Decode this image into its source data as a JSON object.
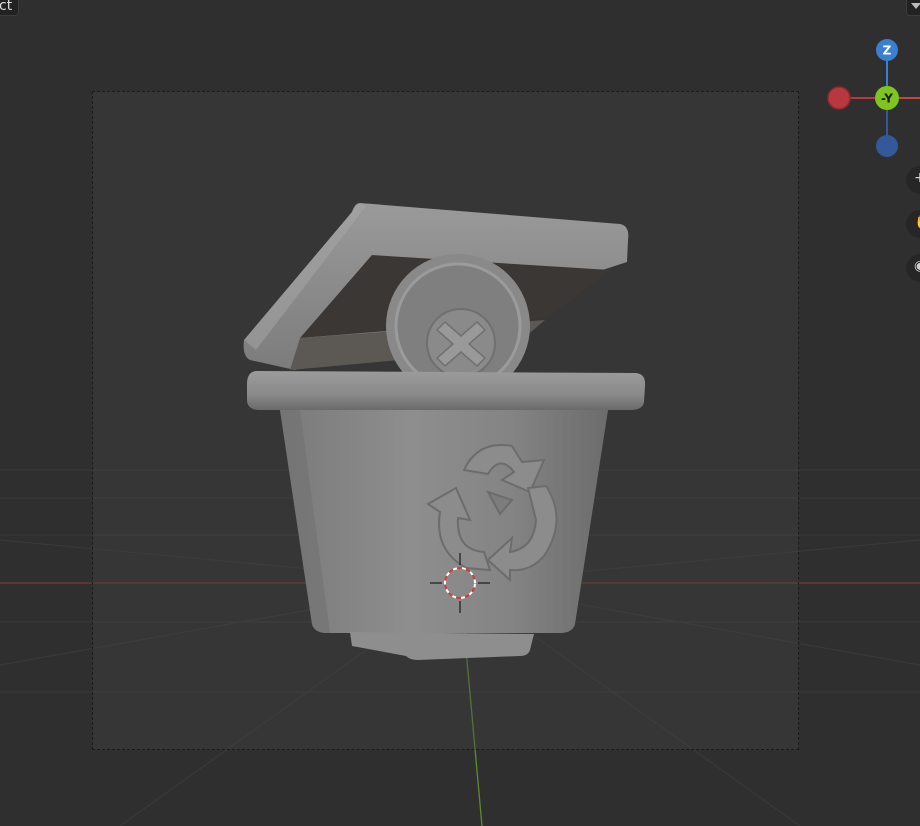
{
  "header": {
    "mode_label": "ct"
  },
  "gizmo": {
    "z_label": "Z",
    "y_label": "-Y",
    "colors": {
      "x_axis": "#c8404a",
      "y_axis": "#7fc41f",
      "z_axis": "#3a7fd0",
      "neg_z": "#34589a",
      "neg_x": "#b9373f"
    }
  },
  "viewport": {
    "object": "recycle-bin-model",
    "colors": {
      "background": "#2f2f2f",
      "x_axis_line": "#8e3a3a",
      "y_axis_line": "#5f8a2d",
      "model": "#8a8a8a"
    }
  },
  "nav_buttons": [
    {
      "icon": "zoom-icon"
    },
    {
      "icon": "pan-icon"
    },
    {
      "icon": "camera-icon"
    }
  ]
}
